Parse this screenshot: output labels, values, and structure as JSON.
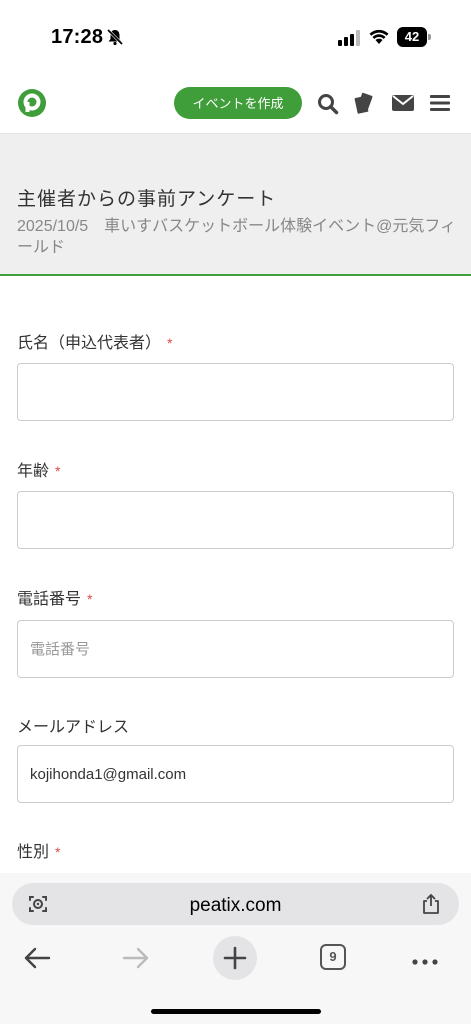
{
  "status_bar": {
    "time": "17:28",
    "battery": "42"
  },
  "header": {
    "create_event_label": "イベントを作成",
    "icons": [
      "peatix-logo-icon",
      "search-icon",
      "tickets-icon",
      "mail-icon",
      "menu-icon"
    ],
    "accent_color": "#3f9d3a"
  },
  "survey": {
    "title": "主催者からの事前アンケート",
    "subtitle": "2025/10/5　車いすバスケットボール体験イベント@元気フィールド"
  },
  "form": {
    "required_mark": "*",
    "fields": [
      {
        "label": "氏名（申込代表者）",
        "required": true,
        "value": "",
        "placeholder": ""
      },
      {
        "label": "年齢",
        "required": true,
        "value": "",
        "placeholder": ""
      },
      {
        "label": "電話番号",
        "required": true,
        "value": "",
        "placeholder": "電話番号"
      },
      {
        "label": "メールアドレス",
        "required": false,
        "value": "kojihonda1@gmail.com",
        "placeholder": ""
      },
      {
        "label": "性別",
        "required": true
      }
    ]
  },
  "browser": {
    "url": "peatix.com",
    "tab_count": "9"
  }
}
